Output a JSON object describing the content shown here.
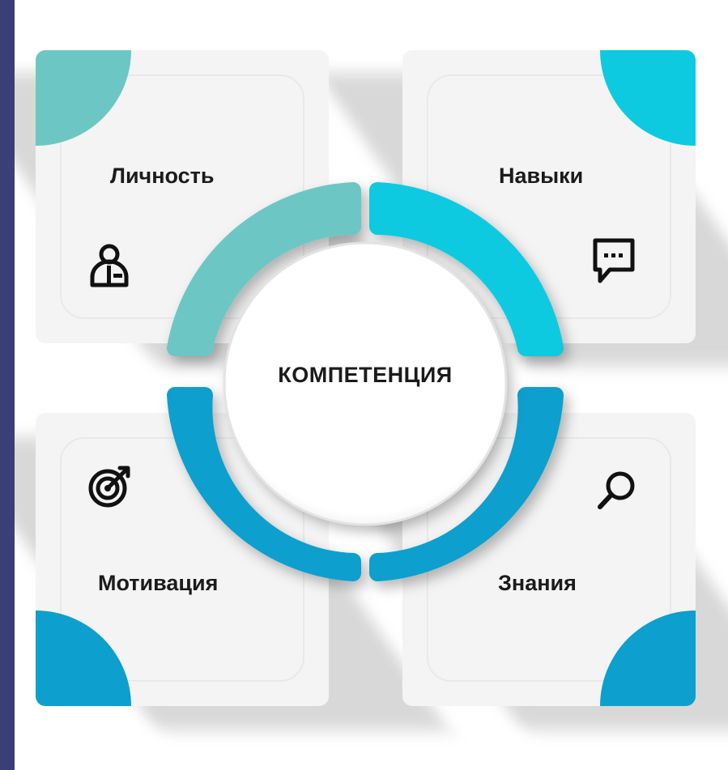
{
  "center": {
    "label": "КОМПЕТЕНЦИЯ"
  },
  "cards": {
    "personality": {
      "title": "Личность",
      "icon": "person-badge-icon",
      "color": "#6cc7c4"
    },
    "skills": {
      "title": "Навыки",
      "icon": "chat-bubble-icon",
      "color": "#0ecae0"
    },
    "motivation": {
      "title": "Мотивация",
      "icon": "target-icon",
      "color": "#0d9fce"
    },
    "knowledge": {
      "title": "Знания",
      "icon": "magnifier-icon",
      "color": "#0d9fce"
    }
  },
  "colors": {
    "frame": "#3b3f78",
    "card": "#f4f4f4",
    "text": "#1b1b1b"
  }
}
